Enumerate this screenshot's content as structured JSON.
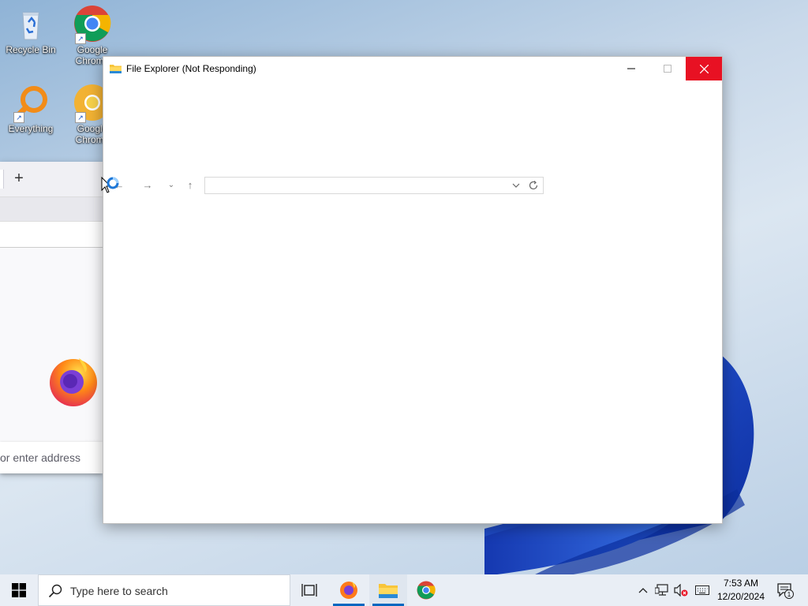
{
  "desktop": {
    "icons": [
      {
        "label": "Recycle Bin",
        "icon": "recycle-bin-icon"
      },
      {
        "label": "Google Chrome",
        "icon": "chrome-icon"
      },
      {
        "label": "Everything",
        "icon": "everything-search-icon"
      },
      {
        "label": "Google Chrome",
        "icon": "chrome-canary-icon"
      }
    ]
  },
  "firefox": {
    "new_tab_label": "+",
    "search_placeholder": "or enter address"
  },
  "explorer": {
    "title": "File Explorer (Not Responding)",
    "address_value": ""
  },
  "taskbar": {
    "search_placeholder": "Type here to search",
    "pinned": [
      {
        "name": "task-view",
        "icon": "task-view-icon"
      },
      {
        "name": "firefox",
        "icon": "firefox-icon",
        "running": true
      },
      {
        "name": "file-explorer",
        "icon": "folder-icon",
        "running": true,
        "active": true
      },
      {
        "name": "chrome",
        "icon": "chrome-icon"
      }
    ],
    "time": "7:53 AM",
    "date": "12/20/2024",
    "notification_count": "1"
  },
  "colors": {
    "close_red": "#e81123",
    "taskbar_bg": "#e9eef5",
    "running_indicator": "#0067c0",
    "wallpaper_blue": "#1f49c9"
  }
}
